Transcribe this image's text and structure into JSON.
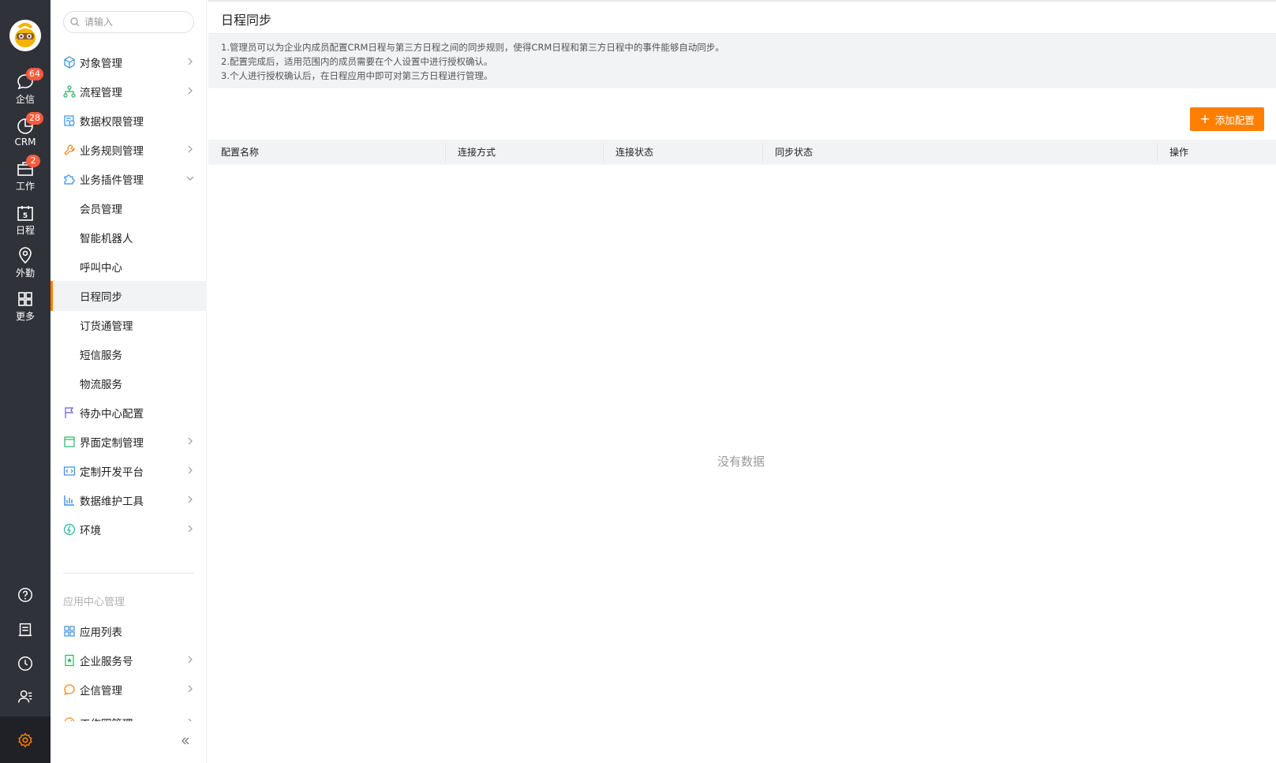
{
  "rail": {
    "items": [
      {
        "label": "企信",
        "badge": "64",
        "icon": "chat-bubble-icon"
      },
      {
        "label": "CRM",
        "badge": "28",
        "icon": "pie-chart-icon"
      },
      {
        "label": "工作",
        "badge": "2",
        "icon": "briefcase-icon"
      },
      {
        "label": "日程",
        "badge": "",
        "icon": "calendar-icon",
        "day": "5"
      },
      {
        "label": "外勤",
        "badge": "",
        "icon": "location-pin-icon"
      },
      {
        "label": "更多",
        "badge": "",
        "icon": "grid-icon"
      }
    ],
    "bottom_icons": [
      "help-icon",
      "notebook-icon",
      "clock-icon",
      "contacts-icon",
      "settings-icon"
    ],
    "colors": {
      "background": "#2f3238",
      "badge": "#ff5a3c",
      "active_icon": "#ff8000"
    }
  },
  "menu": {
    "search_placeholder": "请输入",
    "items": [
      {
        "label": "对象管理",
        "icon": "cube-icon",
        "arrow": "right"
      },
      {
        "label": "流程管理",
        "icon": "flow-tree-icon",
        "arrow": "right"
      },
      {
        "label": "数据权限管理",
        "icon": "data-permission-icon",
        "arrow": ""
      },
      {
        "label": "业务规则管理",
        "icon": "wrench-icon",
        "arrow": "right"
      },
      {
        "label": "业务插件管理",
        "icon": "puzzle-icon",
        "arrow": "down"
      },
      {
        "label": "会员管理",
        "sub": true
      },
      {
        "label": "智能机器人",
        "sub": true
      },
      {
        "label": "呼叫中心",
        "sub": true
      },
      {
        "label": "日程同步",
        "sub": true,
        "active": true
      },
      {
        "label": "订货通管理",
        "sub": true
      },
      {
        "label": "短信服务",
        "sub": true
      },
      {
        "label": "物流服务",
        "sub": true
      },
      {
        "label": "待办中心配置",
        "icon": "flag-icon",
        "arrow": ""
      },
      {
        "label": "界面定制管理",
        "icon": "layout-icon",
        "arrow": "right"
      },
      {
        "label": "定制开发平台",
        "icon": "code-icon",
        "arrow": "right"
      },
      {
        "label": "数据维护工具",
        "icon": "bar-chart-icon",
        "arrow": "right"
      },
      {
        "label": "环境",
        "icon": "environment-icon",
        "arrow": "right"
      }
    ],
    "group_label": "应用中心管理",
    "group_items": [
      {
        "label": "应用列表",
        "icon": "app-grid-icon",
        "arrow": ""
      },
      {
        "label": "企业服务号",
        "icon": "service-account-icon",
        "arrow": "right"
      },
      {
        "label": "企信管理",
        "icon": "message-circle-icon",
        "arrow": "right"
      },
      {
        "label": "工作圈管理",
        "icon": "work-circle-icon",
        "arrow": "right"
      }
    ]
  },
  "main": {
    "title": "日程同步",
    "notice": [
      "1.管理员可以为企业内成员配置CRM日程与第三方日程之间的同步规则，使得CRM日程和第三方日程中的事件能够自动同步。",
      "2.配置完成后，适用范围内的成员需要在个人设置中进行授权确认。",
      "3.个人进行授权确认后，在日程应用中即可对第三方日程进行管理。"
    ],
    "add_button": "添加配置",
    "columns": [
      "配置名称",
      "连接方式",
      "连接状态",
      "同步状态",
      "操作"
    ],
    "empty_text": "没有数据",
    "accent": "#ff8000"
  }
}
